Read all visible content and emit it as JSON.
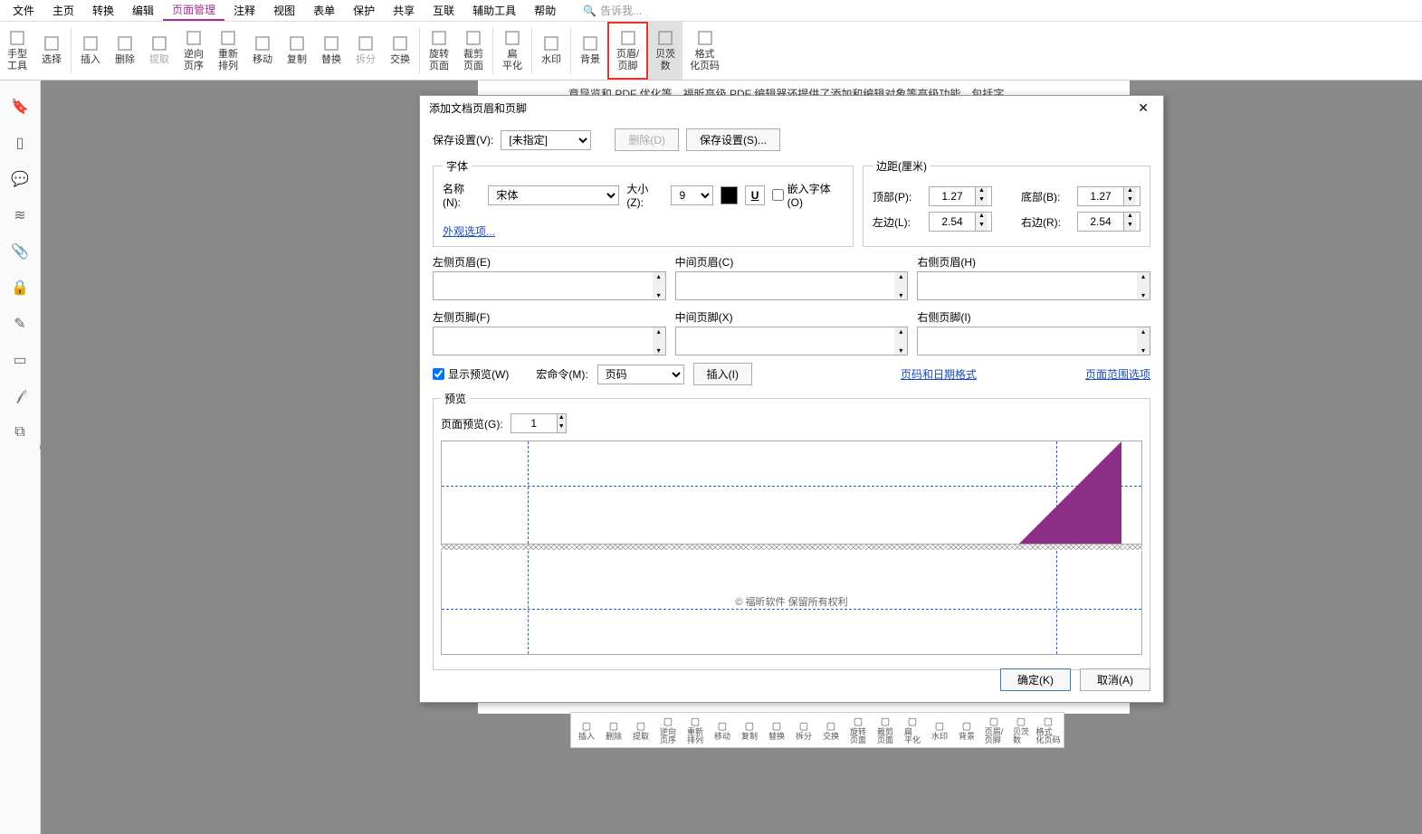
{
  "menu": {
    "items": [
      "文件",
      "主页",
      "转换",
      "编辑",
      "页面管理",
      "注释",
      "视图",
      "表单",
      "保护",
      "共享",
      "互联",
      "辅助工具",
      "帮助"
    ],
    "active_index": 4,
    "search_placeholder": "告诉我..."
  },
  "ribbon": {
    "buttons": [
      {
        "label": "手型\n工具"
      },
      {
        "label": "选择"
      },
      {
        "sep": true
      },
      {
        "label": "插入"
      },
      {
        "label": "删除"
      },
      {
        "label": "提取",
        "disabled": true
      },
      {
        "label": "逆向\n页序"
      },
      {
        "label": "重新\n排列"
      },
      {
        "label": "移动"
      },
      {
        "label": "复制"
      },
      {
        "label": "替换"
      },
      {
        "label": "拆分",
        "disabled": true
      },
      {
        "label": "交换"
      },
      {
        "sep": true
      },
      {
        "label": "旋转\n页面"
      },
      {
        "label": "裁剪\n页面"
      },
      {
        "sep": true
      },
      {
        "label": "扁\n平化"
      },
      {
        "sep": true
      },
      {
        "label": "水印"
      },
      {
        "sep": true
      },
      {
        "label": "背景"
      },
      {
        "label": "页眉/\n页脚",
        "highlighted": true
      },
      {
        "label": "贝茨\n数",
        "selected": true
      },
      {
        "label": "格式\n化页码"
      }
    ]
  },
  "doc_text": "章导览和 PDF 优化等。福昕高级 PDF 编辑器还提供了添加和编辑对象等高级功能，包括字",
  "dialog": {
    "title": "添加文档页眉和页脚",
    "save_settings_label": "保存设置(V):",
    "save_settings_value": "[未指定]",
    "delete_btn": "删除(D)",
    "save_btn": "保存设置(S)...",
    "font_legend": "字体",
    "font_name_label": "名称(N):",
    "font_name_value": "宋体",
    "font_size_label": "大小(Z):",
    "font_size_value": "9",
    "underline_char": "U",
    "embed_font_label": "嵌入字体(O)",
    "appearance_link": "外观选项...",
    "margin_legend": "边距(厘米)",
    "margin_top_label": "顶部(P):",
    "margin_top_value": "1.27",
    "margin_bottom_label": "底部(B):",
    "margin_bottom_value": "1.27",
    "margin_left_label": "左边(L):",
    "margin_left_value": "2.54",
    "margin_right_label": "右边(R):",
    "margin_right_value": "2.54",
    "left_header": "左侧页眉(E)",
    "center_header": "中间页眉(C)",
    "right_header": "右侧页眉(H)",
    "left_footer": "左侧页脚(F)",
    "center_footer": "中间页脚(X)",
    "right_footer": "右侧页脚(I)",
    "show_preview": "显示预览(W)",
    "macro_label": "宏命令(M):",
    "macro_value": "页码",
    "insert_btn": "插入(I)",
    "page_date_link": "页码和日期格式",
    "page_range_link": "页面范围选项",
    "preview_legend": "预览",
    "page_preview_label": "页面预览(G):",
    "page_preview_value": "1",
    "copyright_text": "© 福昕软件 保留所有权利",
    "ok_btn": "确定(K)",
    "cancel_btn": "取消(A)"
  },
  "mini": [
    "插入",
    "删除",
    "提取",
    "逆向\n页序",
    "重新\n排列",
    "移动",
    "复制",
    "替换",
    "拆分",
    "交换",
    "旋转\n页面",
    "裁剪\n页面",
    "扁\n平化",
    "水印",
    "背景",
    "页眉/\n页脚",
    "贝茨\n数",
    "格式\n化页码"
  ]
}
